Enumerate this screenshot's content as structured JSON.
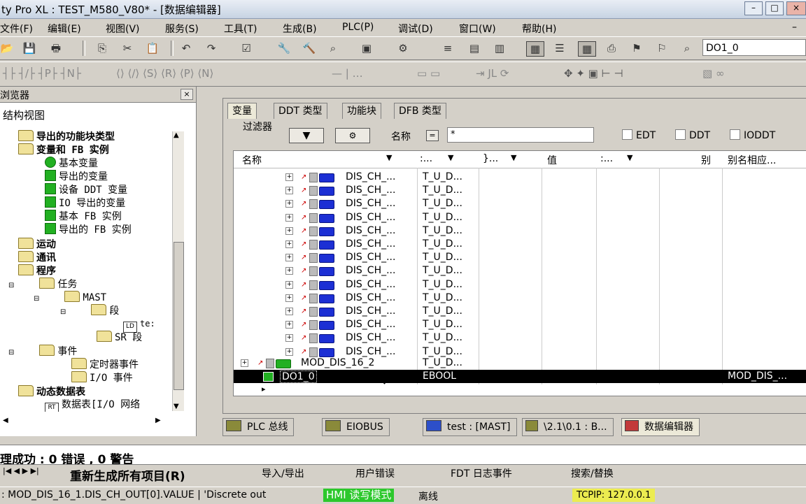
{
  "window": {
    "title": "ty Pro XL : TEST_M580_V80* - [数据编辑器]"
  },
  "menu": [
    "文件(F)",
    "编辑(E)",
    "视图(V)",
    "服务(S)",
    "工具(T)",
    "生成(B)",
    "PLC(P)",
    "调试(D)",
    "窗口(W)",
    "帮助(H)"
  ],
  "toolbar": {
    "find_value": "DO1_0"
  },
  "browser": {
    "title": "浏览器",
    "view_label": "结构视图",
    "tree": [
      {
        "label": "导出的功能块类型",
        "bold": true
      },
      {
        "label": "变量和 FB 实例",
        "bold": true
      },
      {
        "label": "基本变量"
      },
      {
        "label": "导出的变量"
      },
      {
        "label": "设备 DDT 变量"
      },
      {
        "label": "IO 导出的变量"
      },
      {
        "label": "基本 FB 实例"
      },
      {
        "label": "导出的 FB 实例"
      },
      {
        "label": "运动",
        "bold": true
      },
      {
        "label": "通讯",
        "bold": true
      },
      {
        "label": "程序",
        "bold": true
      },
      {
        "label": "任务"
      },
      {
        "label": "MAST"
      },
      {
        "label": "段"
      },
      {
        "label": "te:"
      },
      {
        "label": "SR 段"
      },
      {
        "label": "事件"
      },
      {
        "label": "定时器事件"
      },
      {
        "label": "I/O 事件"
      },
      {
        "label": "动态数据表",
        "bold": true
      },
      {
        "label": "数据表[I/O 网络"
      }
    ]
  },
  "editor": {
    "tabs": [
      "变量",
      "DDT 类型",
      "功能块",
      "DFB 类型"
    ],
    "filter_label": "过滤器",
    "name_label": "名称",
    "name_eq": "=",
    "name_filter_value": "*",
    "checkboxes": [
      "EDT",
      "DDT",
      "IODDT"
    ],
    "columns": {
      "name": "名称",
      "type": ":...",
      "addr": "}...",
      "value": "值",
      "comment": ":...",
      "alias": "别",
      "alias_of": "别名相应..."
    },
    "rows": [
      {
        "name": "DIS_CH_...",
        "type": "T_U_D..."
      },
      {
        "name": "DIS_CH_...",
        "type": "T_U_D..."
      },
      {
        "name": "DIS_CH_...",
        "type": "T_U_D..."
      },
      {
        "name": "DIS_CH_...",
        "type": "T_U_D..."
      },
      {
        "name": "DIS_CH_...",
        "type": "T_U_D..."
      },
      {
        "name": "DIS_CH_...",
        "type": "T_U_D..."
      },
      {
        "name": "DIS_CH_...",
        "type": "T_U_D..."
      },
      {
        "name": "DIS_CH_...",
        "type": "T_U_D..."
      },
      {
        "name": "DIS_CH_...",
        "type": "T_U_D..."
      },
      {
        "name": "DIS_CH_...",
        "type": "T_U_D..."
      },
      {
        "name": "DIS_CH_...",
        "type": "T_U_D..."
      },
      {
        "name": "DIS_CH_...",
        "type": "T_U_D..."
      },
      {
        "name": "DIS_CH_...",
        "type": "T_U_D..."
      },
      {
        "name": "DIS_CH_...",
        "type": "T_U_D..."
      }
    ],
    "module_row": {
      "name": "MOD_DIS_16_2",
      "type": "T_U_D..."
    },
    "selected_row": {
      "name": "DO1_0",
      "type": "EBOOL",
      "alias_of": "MOD_DIS_..."
    }
  },
  "bottom_tabs": [
    "PLC 总线",
    "EIOBUS",
    "test : [MAST]",
    "\\2.1\\0.1 : B...",
    "数据编辑器"
  ],
  "output": {
    "message": "理成功 : 0 错误 , 0 警告",
    "tabs": [
      "重新生成所有项目(R)",
      "导入/导出",
      "用户错误",
      "FDT 日志事件",
      "搜索/替换"
    ]
  },
  "status": {
    "text": ": MOD_DIS_16_1.DIS_CH_OUT[0].VALUE | 'Discrete out",
    "hmi": "HMI 读写模式",
    "offline": "离线",
    "tcpip": "TCPIP: 127.0.0.1"
  },
  "colors": {
    "hmi_bg": "#2cc82c",
    "tcpip_bg": "#ecec50",
    "selected_row_bg": "#000000"
  }
}
